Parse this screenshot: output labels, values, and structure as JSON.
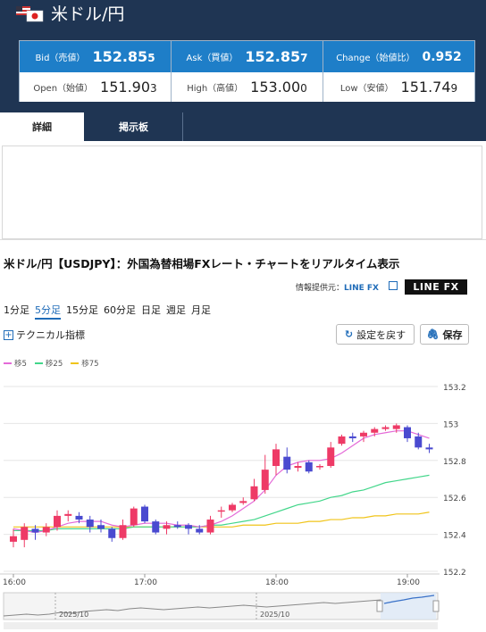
{
  "header": {
    "title": "米ドル/円",
    "bid": {
      "label": "Bid（売値）",
      "value_main": "152.85",
      "value_tail": "5"
    },
    "ask": {
      "label": "Ask（買値）",
      "value_main": "152.85",
      "value_tail": "7"
    },
    "change": {
      "label": "Change（始値比）",
      "value": "0.952"
    },
    "open": {
      "label": "Open（始値）",
      "value_main": "151.90",
      "value_tail": "3"
    },
    "high": {
      "label": "High（高値）",
      "value_main": "153.00",
      "value_tail": "0"
    },
    "low": {
      "label": "Low（安値）",
      "value_main": "151.74",
      "value_tail": "9"
    },
    "colors": {
      "header_bg": "#1f3553",
      "bid_row_bg": "#1e7ec8"
    }
  },
  "tabs": [
    {
      "label": "詳細",
      "active": true
    },
    {
      "label": "掲示板",
      "active": false
    }
  ],
  "section": {
    "title": "米ドル/円【USDJPY】：外国為替相場FXレート・チャートをリアルタイム表示",
    "provider_label": "情報提供元：",
    "provider_name": "LINE FX",
    "logo_text": "LINE FX"
  },
  "periods": [
    {
      "label": "1分足",
      "selected": false
    },
    {
      "label": "5分足",
      "selected": true
    },
    {
      "label": "15分足",
      "selected": false
    },
    {
      "label": "60分足",
      "selected": false
    },
    {
      "label": "日足",
      "selected": false
    },
    {
      "label": "週足",
      "selected": false
    },
    {
      "label": "月足",
      "selected": false
    }
  ],
  "tools": {
    "technical_label": "テクニカル指標",
    "reset_label": "設定を戻す",
    "save_label": "保存"
  },
  "legend": [
    {
      "name": "移5",
      "color": "#e46ad8"
    },
    {
      "name": "移25",
      "color": "#42d68a"
    },
    {
      "name": "移75",
      "color": "#f0c419"
    }
  ],
  "chart_data": {
    "type": "candlestick",
    "ylim": [
      152.2,
      153.2
    ],
    "y_ticks": [
      "153.2",
      "153",
      "152.8",
      "152.6",
      "152.4",
      "152.2"
    ],
    "x_ticks": [
      {
        "label": "16:00",
        "i": 0
      },
      {
        "label": "17:00",
        "i": 12
      },
      {
        "label": "18:00",
        "i": 24
      },
      {
        "label": "19:00",
        "i": 36
      }
    ],
    "up_color": "#ee3a66",
    "down_color": "#4a4ad0",
    "candles": [
      {
        "o": 152.36,
        "h": 152.43,
        "l": 152.33,
        "c": 152.39
      },
      {
        "o": 152.37,
        "h": 152.46,
        "l": 152.33,
        "c": 152.44
      },
      {
        "o": 152.43,
        "h": 152.45,
        "l": 152.37,
        "c": 152.41
      },
      {
        "o": 152.41,
        "h": 152.46,
        "l": 152.39,
        "c": 152.44
      },
      {
        "o": 152.44,
        "h": 152.53,
        "l": 152.42,
        "c": 152.5
      },
      {
        "o": 152.5,
        "h": 152.53,
        "l": 152.47,
        "c": 152.51
      },
      {
        "o": 152.5,
        "h": 152.52,
        "l": 152.46,
        "c": 152.48
      },
      {
        "o": 152.48,
        "h": 152.5,
        "l": 152.41,
        "c": 152.44
      },
      {
        "o": 152.45,
        "h": 152.48,
        "l": 152.41,
        "c": 152.43
      },
      {
        "o": 152.43,
        "h": 152.44,
        "l": 152.36,
        "c": 152.38
      },
      {
        "o": 152.38,
        "h": 152.48,
        "l": 152.37,
        "c": 152.45
      },
      {
        "o": 152.45,
        "h": 152.55,
        "l": 152.44,
        "c": 152.54
      },
      {
        "o": 152.55,
        "h": 152.56,
        "l": 152.46,
        "c": 152.47
      },
      {
        "o": 152.47,
        "h": 152.48,
        "l": 152.4,
        "c": 152.41
      },
      {
        "o": 152.43,
        "h": 152.47,
        "l": 152.4,
        "c": 152.45
      },
      {
        "o": 152.45,
        "h": 152.47,
        "l": 152.43,
        "c": 152.44
      },
      {
        "o": 152.45,
        "h": 152.46,
        "l": 152.4,
        "c": 152.43
      },
      {
        "o": 152.43,
        "h": 152.45,
        "l": 152.4,
        "c": 152.41
      },
      {
        "o": 152.41,
        "h": 152.5,
        "l": 152.4,
        "c": 152.48
      },
      {
        "o": 152.53,
        "h": 152.55,
        "l": 152.49,
        "c": 152.53
      },
      {
        "o": 152.53,
        "h": 152.57,
        "l": 152.52,
        "c": 152.56
      },
      {
        "o": 152.57,
        "h": 152.6,
        "l": 152.56,
        "c": 152.58
      },
      {
        "o": 152.59,
        "h": 152.7,
        "l": 152.58,
        "c": 152.66
      },
      {
        "o": 152.64,
        "h": 152.83,
        "l": 152.62,
        "c": 152.75
      },
      {
        "o": 152.77,
        "h": 152.89,
        "l": 152.72,
        "c": 152.86
      },
      {
        "o": 152.82,
        "h": 152.87,
        "l": 152.73,
        "c": 152.75
      },
      {
        "o": 152.76,
        "h": 152.79,
        "l": 152.74,
        "c": 152.77
      },
      {
        "o": 152.79,
        "h": 152.8,
        "l": 152.73,
        "c": 152.74
      },
      {
        "o": 152.77,
        "h": 152.78,
        "l": 152.75,
        "c": 152.77
      },
      {
        "o": 152.77,
        "h": 152.9,
        "l": 152.76,
        "c": 152.87
      },
      {
        "o": 152.89,
        "h": 152.94,
        "l": 152.88,
        "c": 152.93
      },
      {
        "o": 152.93,
        "h": 152.95,
        "l": 152.9,
        "c": 152.92
      },
      {
        "o": 152.93,
        "h": 152.96,
        "l": 152.9,
        "c": 152.95
      },
      {
        "o": 152.95,
        "h": 152.98,
        "l": 152.93,
        "c": 152.97
      },
      {
        "o": 152.97,
        "h": 152.99,
        "l": 152.96,
        "c": 152.98
      },
      {
        "o": 152.97,
        "h": 153.0,
        "l": 152.95,
        "c": 152.99
      },
      {
        "o": 152.98,
        "h": 152.99,
        "l": 152.9,
        "c": 152.92
      },
      {
        "o": 152.93,
        "h": 152.95,
        "l": 152.86,
        "c": 152.87
      },
      {
        "o": 152.87,
        "h": 152.89,
        "l": 152.84,
        "c": 152.86
      }
    ],
    "ma5": [
      152.43,
      152.42,
      152.41,
      152.42,
      152.44,
      152.46,
      152.47,
      152.47,
      152.47,
      152.45,
      152.44,
      152.45,
      152.46,
      152.46,
      152.46,
      152.45,
      152.45,
      152.44,
      152.45,
      152.47,
      152.5,
      152.54,
      152.58,
      152.64,
      152.72,
      152.77,
      152.79,
      152.8,
      152.8,
      152.81,
      152.84,
      152.88,
      152.92,
      152.94,
      152.95,
      152.96,
      152.96,
      152.94,
      152.92
    ],
    "ma25": [
      152.42,
      152.42,
      152.42,
      152.42,
      152.43,
      152.43,
      152.43,
      152.43,
      152.43,
      152.43,
      152.43,
      152.44,
      152.44,
      152.44,
      152.44,
      152.44,
      152.44,
      152.44,
      152.45,
      152.45,
      152.46,
      152.47,
      152.48,
      152.5,
      152.52,
      152.54,
      152.56,
      152.57,
      152.58,
      152.6,
      152.61,
      152.63,
      152.64,
      152.66,
      152.68,
      152.69,
      152.7,
      152.71,
      152.72
    ],
    "ma75": [
      152.44,
      152.44,
      152.44,
      152.44,
      152.44,
      152.44,
      152.44,
      152.44,
      152.44,
      152.44,
      152.44,
      152.44,
      152.44,
      152.44,
      152.44,
      152.44,
      152.44,
      152.44,
      152.44,
      152.44,
      152.44,
      152.45,
      152.45,
      152.45,
      152.46,
      152.46,
      152.46,
      152.47,
      152.47,
      152.48,
      152.48,
      152.49,
      152.49,
      152.5,
      152.5,
      152.51,
      152.51,
      152.51,
      152.52
    ]
  },
  "navigator": {
    "labels": [
      "2025/10",
      "2025/10"
    ]
  }
}
